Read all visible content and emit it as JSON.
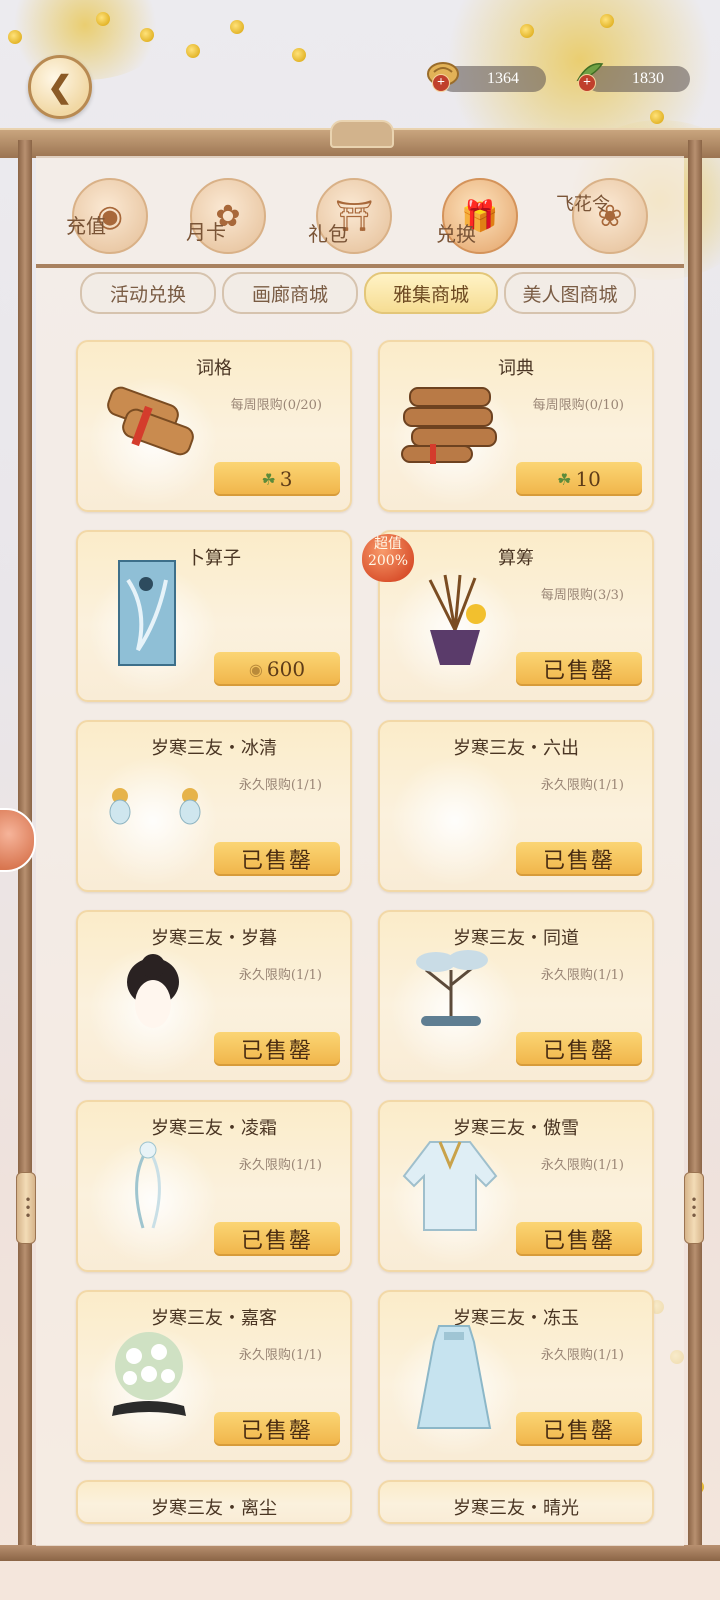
{
  "header": {
    "currencies": [
      {
        "icon": "coin-pouch-icon",
        "value": "1364"
      },
      {
        "icon": "tea-leaf-icon",
        "value": "1830"
      }
    ],
    "plus_symbol": "+"
  },
  "categories": [
    {
      "icon": "coin-icon",
      "label": "充值"
    },
    {
      "icon": "card-icon",
      "label": "月卡"
    },
    {
      "icon": "gift-shrine-icon",
      "label": "礼包"
    },
    {
      "icon": "exchange-gift-icon",
      "label": "兑换",
      "active": true
    },
    {
      "icon": "flower-flag-icon",
      "label": "飞花令"
    }
  ],
  "subtabs": [
    {
      "label": "活动兑换"
    },
    {
      "label": "画廊商城"
    },
    {
      "label": "雅集商城",
      "active": true
    },
    {
      "label": "美人图商城"
    }
  ],
  "items": [
    {
      "title": "词格",
      "limit": "每周限购(0/20)",
      "price": "3",
      "price_icon": "tea-leaf-icon",
      "sold": false
    },
    {
      "title": "词典",
      "limit": "每周限购(0/10)",
      "price": "10",
      "price_icon": "tea-leaf-icon",
      "sold": false
    },
    {
      "title": "卜算子",
      "limit": "",
      "price": "600",
      "price_icon": "coin-pouch-icon",
      "sold": false
    },
    {
      "title": "算筹",
      "limit": "每周限购(3/3)",
      "price": "已售罄",
      "sold": true,
      "badge": {
        "line1": "超值",
        "line2": "200%"
      }
    },
    {
      "title": "岁寒三友・冰清",
      "limit": "永久限购(1/1)",
      "price": "已售罄",
      "sold": true
    },
    {
      "title": "岁寒三友・六出",
      "limit": "永久限购(1/1)",
      "price": "已售罄",
      "sold": true
    },
    {
      "title": "岁寒三友・岁暮",
      "limit": "永久限购(1/1)",
      "price": "已售罄",
      "sold": true
    },
    {
      "title": "岁寒三友・同道",
      "limit": "永久限购(1/1)",
      "price": "已售罄",
      "sold": true
    },
    {
      "title": "岁寒三友・凌霜",
      "limit": "永久限购(1/1)",
      "price": "已售罄",
      "sold": true
    },
    {
      "title": "岁寒三友・傲雪",
      "limit": "永久限购(1/1)",
      "price": "已售罄",
      "sold": true
    },
    {
      "title": "岁寒三友・嘉客",
      "limit": "永久限购(1/1)",
      "price": "已售罄",
      "sold": true
    },
    {
      "title": "岁寒三友・冻玉",
      "limit": "永久限购(1/1)",
      "price": "已售罄",
      "sold": true
    },
    {
      "title": "岁寒三友・离尘",
      "limit": "",
      "price": "",
      "sold": false
    },
    {
      "title": "岁寒三友・晴光",
      "limit": "",
      "price": "",
      "sold": false
    }
  ]
}
